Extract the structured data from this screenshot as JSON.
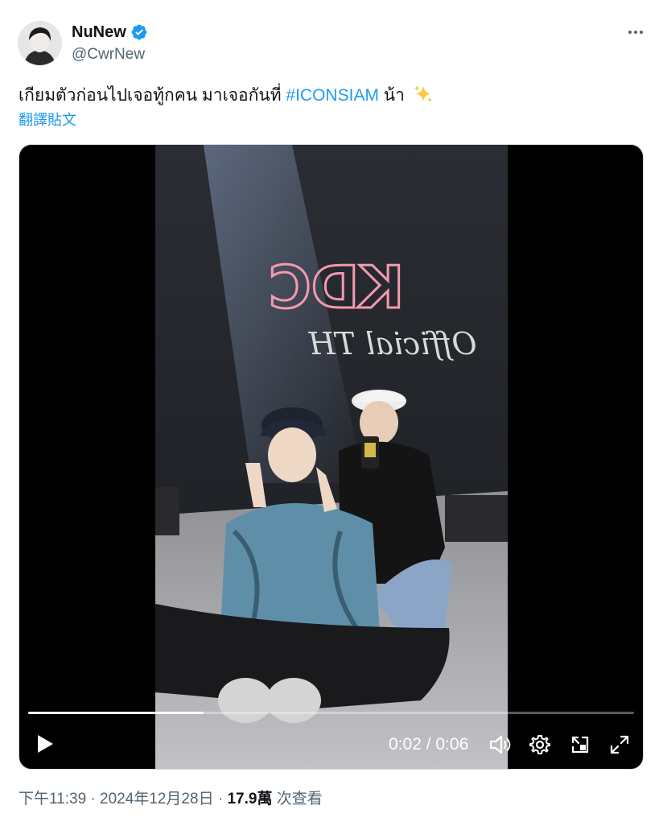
{
  "author": {
    "name": "NuNew",
    "handle": "@CwrNew",
    "verified": true
  },
  "tweet": {
    "text_before": "เกียมตัวก่อนไปเจอทู้กคน มาเจอกันที่ ",
    "hashtag": "#ICONSIAM",
    "text_after": " น้า",
    "emoji": "sparkles-icon",
    "translate_label": "翻譯貼文"
  },
  "video": {
    "current_time": "0:02",
    "duration": "0:06",
    "time_display": "0:02 / 0:06",
    "progress": 0.29,
    "wall_sign": "KDC",
    "wall_script": "Official TH"
  },
  "meta": {
    "time": "下午11:39",
    "separator1": " · ",
    "date": "2024年12月28日",
    "separator2": " · ",
    "views_count": "17.9萬",
    "views_label": " 次查看"
  },
  "colors": {
    "accent": "#1d9bf0",
    "text": "#0f1419",
    "secondary": "#536471",
    "neon": "#f39aae"
  }
}
